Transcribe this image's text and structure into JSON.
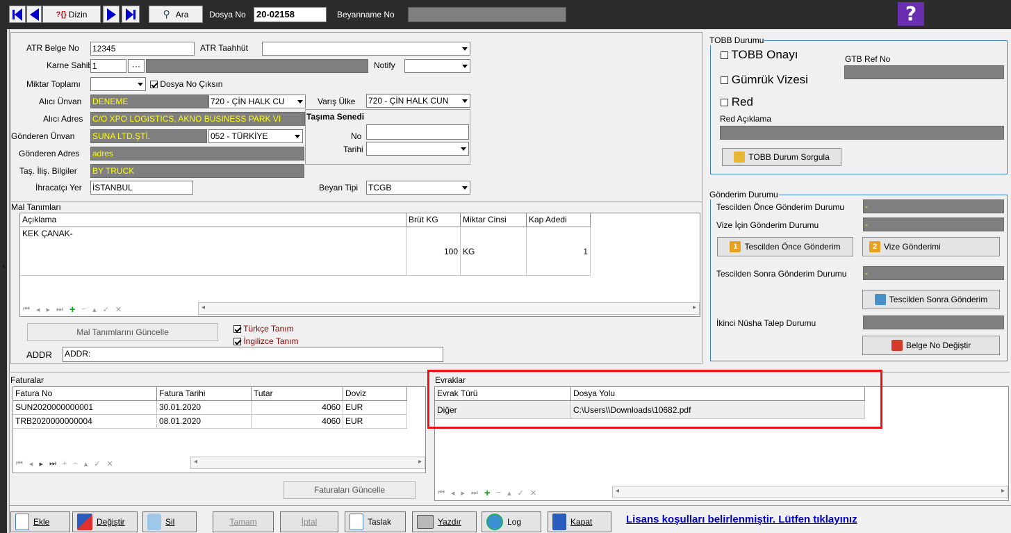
{
  "toolbar": {
    "dizin_label": "Dizin",
    "ara_label": "Ara",
    "dosya_no_label": "Dosya No",
    "dosya_no_value": "20-02158",
    "beyanname_no_label": "Beyanname No"
  },
  "form": {
    "atr_belge_no_label": "ATR Belge No",
    "atr_belge_no_value": "12345",
    "atr_taahhut_label": "ATR Taahhüt",
    "karne_sahibi_label": "Karne Sahibi",
    "karne_sahibi_value": "1",
    "karne_btn": "···",
    "notify_label": "Notify",
    "miktar_toplami_label": "Miktar Toplamı",
    "dosya_no_ciksin_label": "Dosya No Çıksın",
    "alici_unvan_label": "Alıcı Ünvan",
    "alici_unvan_value": "DENEME",
    "alici_ulke_value": "720 - ÇİN HALK CU",
    "varis_ulke_label": "Varış Ülke",
    "varis_ulke_value": "720 - ÇİN HALK CUN",
    "alici_adres_label": "Alıcı Adres",
    "alici_adres_value": "C/O XPO LOGISTICS, AKNO BUSINESS PARK VI",
    "tasima_senedi_label": "Taşıma Senedi",
    "no_label": "No",
    "tarihi_label": "Tarihi",
    "gonderen_unvan_label": "Gönderen Ünvan",
    "gonderen_unvan_value": "SUNA LTD.ŞTİ.",
    "gonderen_ulke_value": "052 - TÜRKİYE",
    "gonderen_adres_label": "Gönderen Adres",
    "gonderen_adres_value": "adres",
    "tas_ilis_label": "Taş. İliş. Bilgiler",
    "tas_ilis_value": "BY TRUCK",
    "ihracatci_yer_label": "İhracatçı Yer",
    "ihracatci_yer_value": "İSTANBUL",
    "beyan_tipi_label": "Beyan Tipi",
    "beyan_tipi_value": "TCGB"
  },
  "mal": {
    "title": "Mal Tanımları",
    "headers": [
      "Açıklama",
      "Brüt KG",
      "Miktar Cinsi",
      "Kap Adedi"
    ],
    "row": {
      "aciklama": "KEK ÇANAK-",
      "brut": "100",
      "cins": "KG",
      "kap": "1"
    },
    "update_btn": "Mal Tanımlarını Güncelle",
    "turkce_label": "Türkçe Tanım",
    "ingilizce_label": "İngilizce Tanım",
    "addr_label": "ADDR",
    "addr_value": "ADDR:"
  },
  "tobb": {
    "title": "TOBB Durumu",
    "onayi_label": "TOBB Onayı",
    "gumruk_label": "Gümrük Vizesi",
    "red_label": "Red",
    "gtb_ref_label": "GTB Ref No",
    "red_aciklama_label": "Red Açıklama",
    "sorgula_btn": "TOBB Durum Sorgula"
  },
  "gonderim": {
    "title": "Gönderim Durumu",
    "tescil_once_label": "Tescilden Önce Gönderim Durumu",
    "tescil_once_value": "-",
    "vize_label": "Vize İçin Gönderim Durumu",
    "vize_value": "-",
    "tescil_once_btn": "Tescilden Önce Gönderim",
    "tescil_once_num": "1",
    "vize_btn": "Vize Gönderimi",
    "vize_num": "2",
    "tescil_sonra_label": "Tescilden Sonra Gönderim Durumu",
    "tescil_sonra_value": "-",
    "tescil_sonra_btn": "Tescilden Sonra Gönderim",
    "ikinci_label": "İkinci Nüsha Talep Durumu",
    "belge_btn": "Belge No Değiştir"
  },
  "faturalar": {
    "title": "Faturalar",
    "headers": [
      "Fatura No",
      "Fatura Tarihi",
      "Tutar",
      "Doviz"
    ],
    "rows": [
      {
        "no": "SUN2020000000001",
        "tarih": "30.01.2020",
        "tutar": "4060",
        "doviz": "EUR"
      },
      {
        "no": "TRB2020000000004",
        "tarih": "08.01.2020",
        "tutar": "4060",
        "doviz": "EUR"
      }
    ],
    "update_btn": "Faturaları Güncelle"
  },
  "evraklar": {
    "title": "Evraklar",
    "headers": [
      "Evrak Türü",
      "Dosya Yolu"
    ],
    "rows": [
      {
        "tur": "Diğer",
        "yol": "C:\\Users\\\\Downloads\\10682.pdf"
      }
    ]
  },
  "bottom": {
    "ekle": "Ekle",
    "degistir": "Değiştir",
    "sil": "Sil",
    "tamam": "Tamam",
    "iptal": "İptal",
    "taslak": "Taslak",
    "yazdir": "Yazdır",
    "log": "Log",
    "kapat": "Kapat",
    "license": "Lisans koşulları belirlenmiştir. Lütfen tıklayınız"
  },
  "colors": {
    "accent": "#0000cc",
    "highlight": "#e8141c",
    "field_gray": "#7f7f7f",
    "field_text": "#ffff00"
  }
}
